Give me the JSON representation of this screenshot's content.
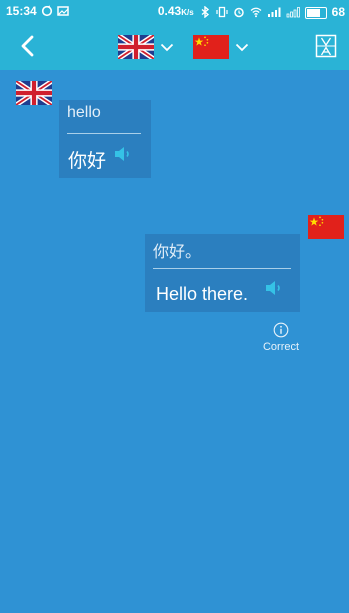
{
  "status_bar": {
    "time": "15:34",
    "net_speed": "0.43",
    "net_unit": "K/s",
    "signal_text": "all",
    "battery": "68"
  },
  "app_bar": {
    "from_language_icon": "uk-flag-icon",
    "to_language_icon": "china-flag-icon",
    "translate_icon": "translate-icon"
  },
  "conversation": {
    "messages": [
      {
        "speaker": "uk-flag-icon",
        "source_text": "hello",
        "translated_text": "你好"
      },
      {
        "speaker": "china-flag-icon",
        "source_text": "你好。",
        "translated_text": "Hello there."
      }
    ],
    "correct_label": "Correct"
  },
  "colors": {
    "status_bar": "#2ab3d6",
    "background": "#2f92d4",
    "bubble": "#2b7fbf",
    "speaker_icon": "#35c2e6"
  }
}
